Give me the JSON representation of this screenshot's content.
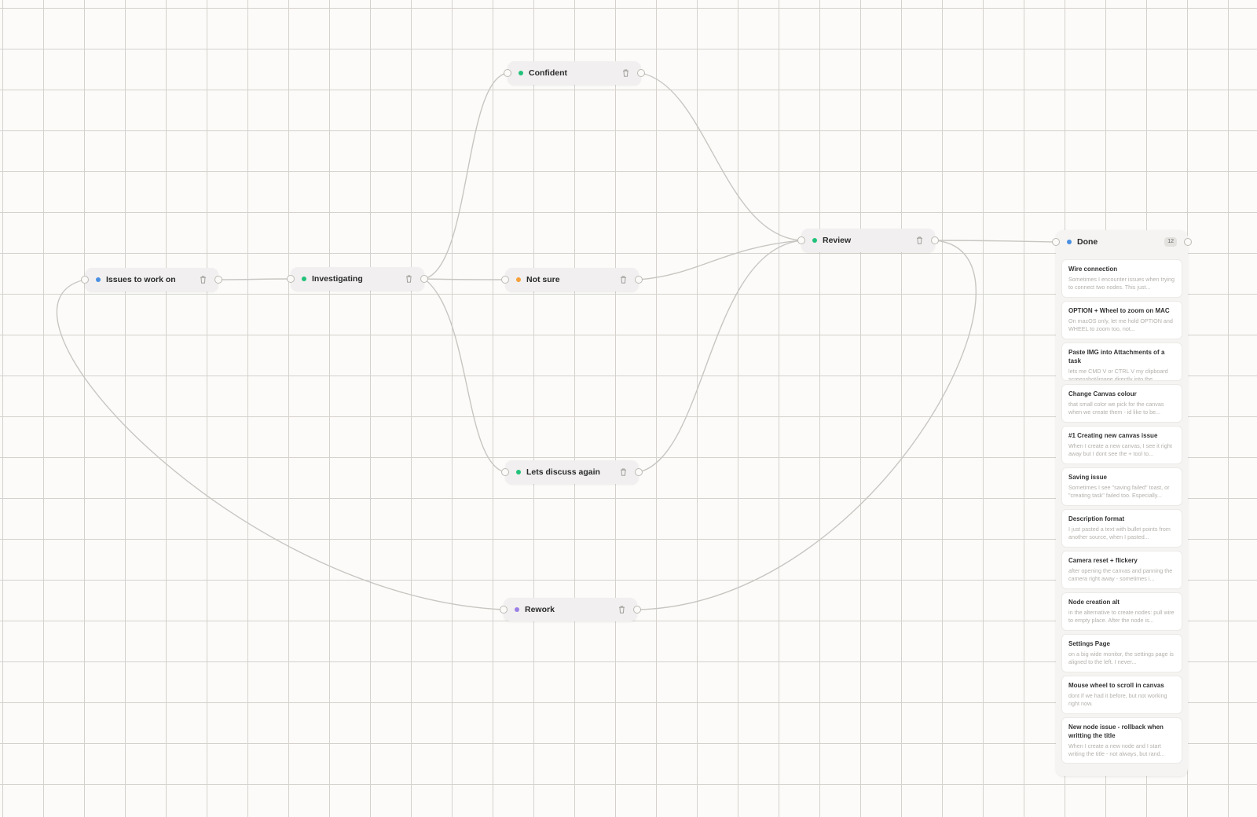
{
  "colors": {
    "blue": "#4a90e2",
    "green": "#22c17a",
    "orange": "#f5a03c",
    "purple": "#9b7fe6"
  },
  "nodes": [
    {
      "id": "issues",
      "label": "Issues to work on",
      "status_color": "blue",
      "icon": "trash-icon"
    },
    {
      "id": "investigating",
      "label": "Investigating",
      "status_color": "green",
      "icon": "trash-icon"
    },
    {
      "id": "confident",
      "label": "Confident",
      "status_color": "green",
      "icon": "trash-icon"
    },
    {
      "id": "notsure",
      "label": "Not sure",
      "status_color": "orange",
      "icon": "trash-icon"
    },
    {
      "id": "discuss",
      "label": "Lets discuss again",
      "status_color": "green",
      "icon": "trash-icon"
    },
    {
      "id": "rework",
      "label": "Rework",
      "status_color": "purple",
      "icon": "trash-icon"
    },
    {
      "id": "review",
      "label": "Review",
      "status_color": "green",
      "icon": "trash-icon"
    }
  ],
  "connections": [
    [
      "issues",
      "investigating"
    ],
    [
      "investigating",
      "confident"
    ],
    [
      "investigating",
      "notsure"
    ],
    [
      "investigating",
      "discuss"
    ],
    [
      "confident",
      "review"
    ],
    [
      "notsure",
      "review"
    ],
    [
      "discuss",
      "review"
    ],
    [
      "review",
      "done"
    ],
    [
      "review",
      "rework"
    ],
    [
      "rework",
      "issues"
    ]
  ],
  "done": {
    "label": "Done",
    "status_color": "blue",
    "count": "12",
    "cards": [
      {
        "title": "Wire connection",
        "description": "Sometimes I encounter issues when trying to connect two nodes. This just..."
      },
      {
        "title": "OPTION + Wheel to zoom on MAC",
        "description": "On macOS only, let me hold OPTION and WHEEL to zoom too, not..."
      },
      {
        "title": "Paste IMG into Attachments of a task",
        "description": "lets me CMD V or CTRL V my clipboard screenshot/image directly into the..."
      },
      {
        "title": "Change Canvas colour",
        "description": "that small color we pick for the canvas when we create them - id like to be..."
      },
      {
        "title": "#1 Creating new canvas issue",
        "description": "When I create a new canvas, I see it right away but I dont see the + tool to..."
      },
      {
        "title": "Saving issue",
        "description": "Sometimes I see \"saving failed\" toast, or \"creating task\" failed too. Especially..."
      },
      {
        "title": "Description format",
        "description": "I just pasted a text with bullet points from another source, when I pasted..."
      },
      {
        "title": "Camera reset + flickery",
        "description": "after opening the canvas and panning the camera right away - sometimes i..."
      },
      {
        "title": "Node creation alt",
        "description": "in the alternative to create nodes: pull wire to empty place. After the node is..."
      },
      {
        "title": "Settings Page",
        "description": "on a big wide monitor, the settings page is aligned to the left. I never..."
      },
      {
        "title": "Mouse wheel to scroll in canvas",
        "description": "dont if we had it before, but not working right now."
      },
      {
        "title": "New node issue - rollback when writting the title",
        "description": "When I create a new node and I start writing the title - not always, but rand..."
      }
    ]
  }
}
